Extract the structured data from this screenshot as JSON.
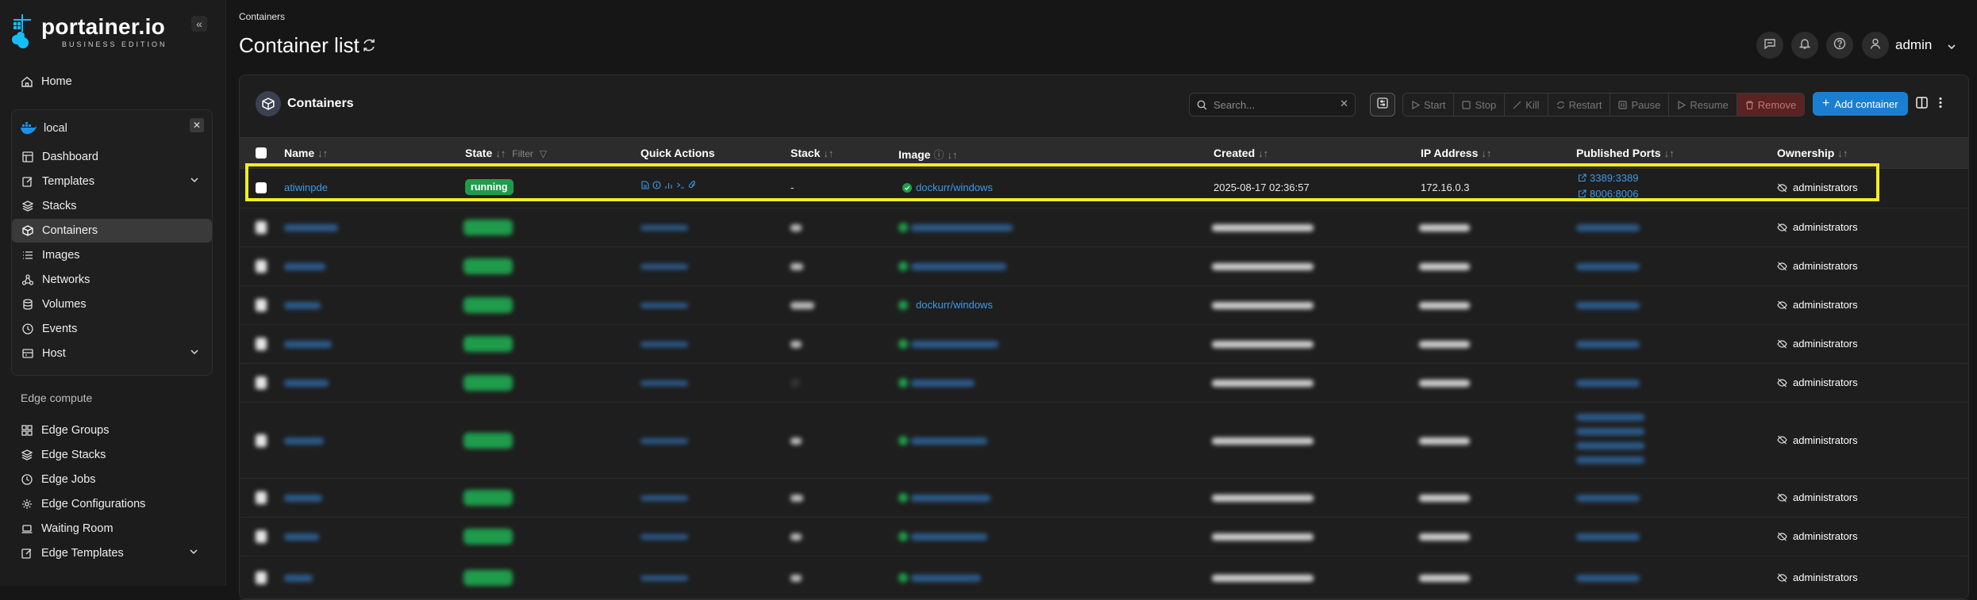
{
  "app": {
    "logo_name": "portainer.io",
    "logo_edition": "BUSINESS EDITION"
  },
  "sidebar": {
    "home": "Home",
    "environment": {
      "name": "local"
    },
    "env_items": [
      {
        "label": "Dashboard",
        "icon": "dashboard-icon"
      },
      {
        "label": "Templates",
        "icon": "edit-icon",
        "expandable": true
      },
      {
        "label": "Stacks",
        "icon": "layers-icon"
      },
      {
        "label": "Containers",
        "icon": "box-icon",
        "active": true
      },
      {
        "label": "Images",
        "icon": "list-icon"
      },
      {
        "label": "Networks",
        "icon": "network-icon"
      },
      {
        "label": "Volumes",
        "icon": "database-icon"
      },
      {
        "label": "Events",
        "icon": "clock-icon"
      },
      {
        "label": "Host",
        "icon": "host-icon",
        "expandable": true
      }
    ],
    "edge_section": "Edge compute",
    "edge_items": [
      {
        "label": "Edge Groups",
        "icon": "grid-icon"
      },
      {
        "label": "Edge Stacks",
        "icon": "layers-icon"
      },
      {
        "label": "Edge Jobs",
        "icon": "clock-icon"
      },
      {
        "label": "Edge Configurations",
        "icon": "gear-icon"
      },
      {
        "label": "Waiting Room",
        "icon": "laptop-icon"
      },
      {
        "label": "Edge Templates",
        "icon": "edit-icon",
        "expandable": true
      }
    ]
  },
  "header": {
    "breadcrumb": "Containers",
    "title": "Container list",
    "user": "admin"
  },
  "panel": {
    "title": "Containers",
    "search_placeholder": "Search...",
    "actions": [
      "Start",
      "Stop",
      "Kill",
      "Restart",
      "Pause",
      "Resume",
      "Remove"
    ],
    "add_button": "Add container"
  },
  "table": {
    "columns": {
      "name": "Name",
      "state": "State",
      "state_filter": "Filter",
      "quick_actions": "Quick Actions",
      "stack": "Stack",
      "image": "Image",
      "created": "Created",
      "ip": "IP Address",
      "ports": "Published Ports",
      "ownership": "Ownership"
    },
    "highlighted_row": {
      "name": "atiwinpde",
      "state": "running",
      "stack": "-",
      "image": "dockurr/windows",
      "created": "2025-08-17 02:36:57",
      "ip": "172.16.0.3",
      "ports": [
        "3389:3389",
        "8006:8006"
      ],
      "ownership": "administrators"
    },
    "blurred_rows": [
      {
        "ownership": "administrators",
        "visible_image": ""
      },
      {
        "ownership": "administrators",
        "visible_image": ""
      },
      {
        "ownership": "administrators",
        "visible_image": "dockurr/windows"
      },
      {
        "ownership": "administrators",
        "visible_image": ""
      },
      {
        "ownership": "administrators",
        "visible_image": ""
      },
      {
        "ownership": "administrators",
        "visible_image": ""
      },
      {
        "ownership": "administrators",
        "visible_image": ""
      },
      {
        "ownership": "administrators",
        "visible_image": ""
      },
      {
        "ownership": "administrators",
        "visible_image": ""
      }
    ]
  },
  "colors": {
    "accent": "#1a7fd1",
    "running": "#1e9c4b",
    "highlight": "#f2ef1c",
    "link": "#3b9bea"
  }
}
